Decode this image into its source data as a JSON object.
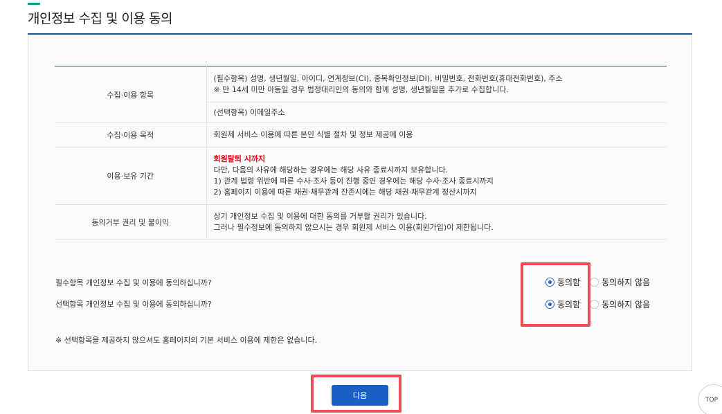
{
  "page": {
    "title": "개인정보 수집 및 이용 동의"
  },
  "table": {
    "rows": [
      {
        "label": "수집·이용 항목",
        "required_line1": "(필수항목) 성명, 생년월일, 아이디, 연계정보(CI), 중복확인정보(DI), 비밀번호, 전화번호(휴대전화번호), 주소",
        "required_line2": "※ 만 14세 미만 아동일 경우 법정대리인의 동의와 함께 성명, 생년월일을 추가로 수집합니다.",
        "optional": "(선택항목) 이메일주소"
      },
      {
        "label": "수집·이용 목적",
        "value": "회원제 서비스 이용에 따른 본인 식별 절차 및 정보 제공에 이용"
      },
      {
        "label": "이용·보유 기간",
        "highlight": "회원탈퇴 시까지",
        "line1": "다만, 다음의 사유에 해당하는 경우에는 해당 사유 종료시까지 보유합니다.",
        "line2": "1) 관계 법령 위반에 따른 수사·조사 등이 진행 중인 경우에는 해당 수사·조사 종료시까지",
        "line3": "2) 홈페이지 이용에 따른 채권·채무관계 잔존시에는 해당 채권·채무관계 정산시까지"
      },
      {
        "label": "동의거부 권리 및 불이익",
        "line1": "상기 개인정보 수집 및 이용에 대한 동의를 거부할 권리가 있습니다.",
        "line2": "그러나 필수정보에 동의하지 않으시는 경우 회원제 서비스 이용(회원가입)이 제한됩니다."
      }
    ]
  },
  "consent": {
    "required_question": "필수항목 개인정보 수집 및 이용에 동의하십니까?",
    "optional_question": "선택항목 개인정보 수집 및 이용에 동의하십니까?",
    "agree_label": "동의함",
    "disagree_label": "동의하지 않음",
    "required_selected": "agree",
    "optional_selected": "agree"
  },
  "notice": "※ 선택항목을 제공하지 않으셔도 홈페이지의 기본 서비스 이용에 제한은 없습니다.",
  "buttons": {
    "next_label": "다음",
    "top_label": "TOP"
  },
  "colors": {
    "accent": "#1f4e8c",
    "button": "#1c5fc2",
    "warning": "#e60012",
    "highlight_box": "#ee4d55"
  }
}
